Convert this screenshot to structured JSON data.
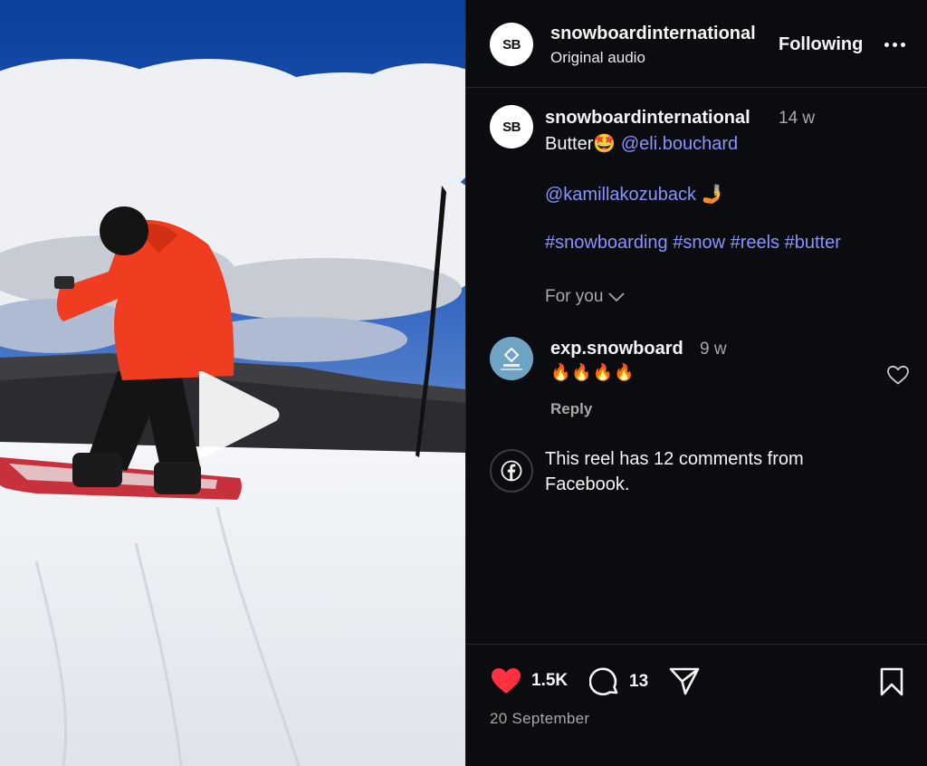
{
  "header": {
    "avatar_initials": "SB",
    "username": "snowboardinternational",
    "audio": "Original audio",
    "follow_label": "Following",
    "more_icon": "more-horizontal-icon"
  },
  "caption": {
    "avatar_initials": "SB",
    "username": "snowboardinternational",
    "age": "14 w",
    "text_lead": "Butter🤩",
    "mention_1": "@eli.bouchard",
    "mention_2": "@kamillakozuback",
    "mention_2_emoji": "🤳",
    "hashtags": "#snowboarding #snow #reels #butter",
    "for_you": "For you"
  },
  "comment": {
    "username": "exp.snowboard",
    "age": "9 w",
    "text": "🔥🔥🔥🔥",
    "reply_label": "Reply"
  },
  "facebook_note": {
    "text": "This reel has 12 comments from Facebook."
  },
  "actions": {
    "likes": "1.5K",
    "comments": "13",
    "date": "20 September"
  },
  "colors": {
    "panel_bg": "#0b0c0f",
    "link": "#8b93ff",
    "like_red": "#ff3040",
    "muted": "#a8a8a8"
  }
}
